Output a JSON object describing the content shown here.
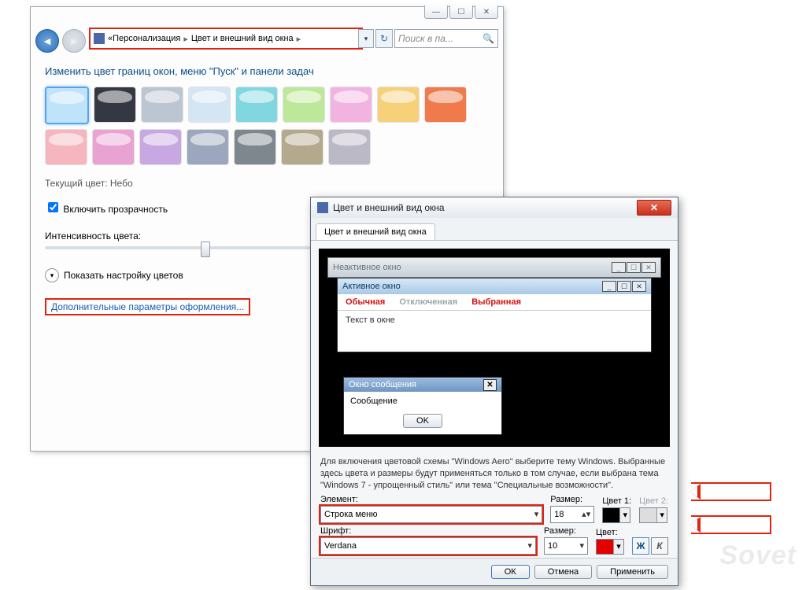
{
  "main": {
    "breadcrumb": {
      "lev1": "Персонализация",
      "lev2": "Цвет и внешний вид окна",
      "prefix": "«"
    },
    "search_placeholder": "Поиск в па...",
    "heading": "Изменить цвет границ окон, меню \"Пуск\" и панели задач",
    "swatch_colors": [
      "#bfe3fb",
      "#333842",
      "#bcc6d3",
      "#d4e6f4",
      "#80d7e0",
      "#bde89a",
      "#f3b3e1",
      "#f7d07a",
      "#f07a4b",
      "#f6b6bf",
      "#e9a3d2",
      "#c7a8e3",
      "#9ca6bd",
      "#7e868e",
      "#b4a88d",
      "#bcb9c6"
    ],
    "current_label": "Текущий цвет:",
    "current_value": "Небо",
    "transparency": "Включить прозрачность",
    "intensity": "Интенсивность цвета:",
    "expand": "Показать настройку цветов",
    "advanced": "Дополнительные параметры оформления..."
  },
  "dlg": {
    "title": "Цвет и внешний вид окна",
    "tab": "Цвет и внешний вид окна",
    "preview": {
      "inactive": "Неактивное окно",
      "active": "Активное окно",
      "menu1": "Обычная",
      "menu2": "Отключенная",
      "menu3": "Выбранная",
      "text": "Текст в окне",
      "msg_title": "Окно сообщения",
      "msg_body": "Сообщение",
      "ok": "OK"
    },
    "desc": "Для включения цветовой схемы \"Windows Aero\" выберите тему Windows. Выбранные здесь цвета и размеры будут применяться только в том случае, если выбрана тема \"Windows 7 - упрощенный стиль\" или тема \"Специальные возможности\".",
    "element_label": "Элемент:",
    "element_value": "Строка меню",
    "size_label": "Размер:",
    "size1": "18",
    "color1_label": "Цвет 1:",
    "color2_label": "Цвет 2:",
    "font_label": "Шрифт:",
    "font_value": "Verdana",
    "size2": "10",
    "color_label": "Цвет:",
    "bold": "Ж",
    "italic": "К",
    "ok": "ОК",
    "cancel": "Отмена",
    "apply": "Применить"
  },
  "watermark": "Sovet"
}
